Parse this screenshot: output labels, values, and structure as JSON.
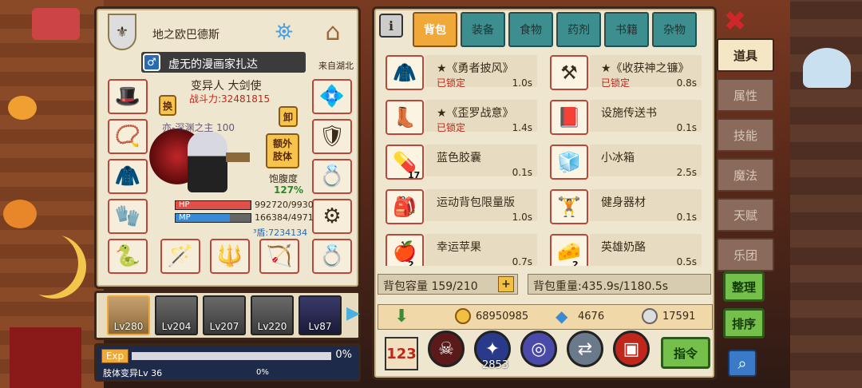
{
  "character": {
    "name": "地之欧巴德斯",
    "title": "虚无的漫画家扎达",
    "origin": "来自湖北",
    "class_line": "变异人 大剑使",
    "power_label": "战斗力:32481815",
    "swap_label": "换",
    "unload_label": "卸",
    "extra_limb_label": "额外\n肢体",
    "satiety_label": "饱腹度",
    "satiety_value": "127%",
    "hp_label": "HP",
    "hp_value": "992720/9930",
    "mp_label": "MP",
    "mp_value": "166384/4971",
    "shield_value": "³盾:7234134",
    "hp_fill": 0.99,
    "mp_fill": 0.72,
    "overlay_text": "亦-深渊之主 100"
  },
  "party": {
    "members": [
      {
        "level": "Lv280"
      },
      {
        "level": "Lv204"
      },
      {
        "level": "Lv207"
      },
      {
        "level": "Lv220"
      },
      {
        "level": "Lv87"
      }
    ]
  },
  "exp": {
    "label": "Exp",
    "percent": "0%",
    "sub_label": "肢体变异Lv 36",
    "sub_percent": "0%",
    "fill": 0.0
  },
  "inventory": {
    "tabs": [
      "背包",
      "装备",
      "食物",
      "药剂",
      "书籍",
      "杂物"
    ],
    "active_tab": "背包",
    "items": [
      {
        "name": "★《勇者披风》",
        "lock": "已锁定",
        "weight": "1.0s",
        "count": "",
        "icon": "cape-icon",
        "glyph": "🧥"
      },
      {
        "name": "★《收获神之镰》",
        "lock": "已锁定",
        "weight": "0.8s",
        "count": "",
        "icon": "scythe-icon",
        "glyph": "⚒"
      },
      {
        "name": "★《歪罗战意》",
        "lock": "已锁定",
        "weight": "1.4s",
        "count": "",
        "icon": "boots-icon",
        "glyph": "👢"
      },
      {
        "name": "设施传送书",
        "lock": "",
        "weight": "0.1s",
        "count": "",
        "icon": "teleport-book-icon",
        "glyph": "📕"
      },
      {
        "name": "蓝色胶囊",
        "lock": "",
        "weight": "0.1s",
        "count": "17",
        "icon": "capsule-icon",
        "glyph": "💊"
      },
      {
        "name": "小冰箱",
        "lock": "",
        "weight": "2.5s",
        "count": "",
        "icon": "fridge-icon",
        "glyph": "🧊"
      },
      {
        "name": "运动背包限量版",
        "lock": "",
        "weight": "1.0s",
        "count": "",
        "icon": "backpack-icon",
        "glyph": "🎒"
      },
      {
        "name": "健身器材",
        "lock": "",
        "weight": "0.1s",
        "count": "",
        "icon": "fitness-icon",
        "glyph": "🏋"
      },
      {
        "name": "幸运苹果",
        "lock": "",
        "weight": "0.7s",
        "count": "2",
        "icon": "apple-icon",
        "glyph": "🍎"
      },
      {
        "name": "英雄奶酪",
        "lock": "",
        "weight": "0.5s",
        "count": "2",
        "icon": "cheese-icon",
        "glyph": "🧀"
      }
    ],
    "capacity_label": "背包容量 159/210",
    "weight_label": "背包重量:435.9s/1180.5s",
    "add_label": "+"
  },
  "currency": {
    "gold": "68950985",
    "gems": "4676",
    "silver": "17591"
  },
  "actions": {
    "ability_count": "2853",
    "command_label": "指令",
    "sort_label": "整理",
    "order_label": "排序"
  },
  "side_tabs": [
    "道具",
    "属性",
    "技能",
    "魔法",
    "天赋",
    "乐团"
  ],
  "colors": {
    "hp": "#e0504a",
    "mp": "#3a8ad6",
    "lock": "#c0261a",
    "tab_active": "#f0a938",
    "tab_inactive": "#3d8e8e"
  }
}
